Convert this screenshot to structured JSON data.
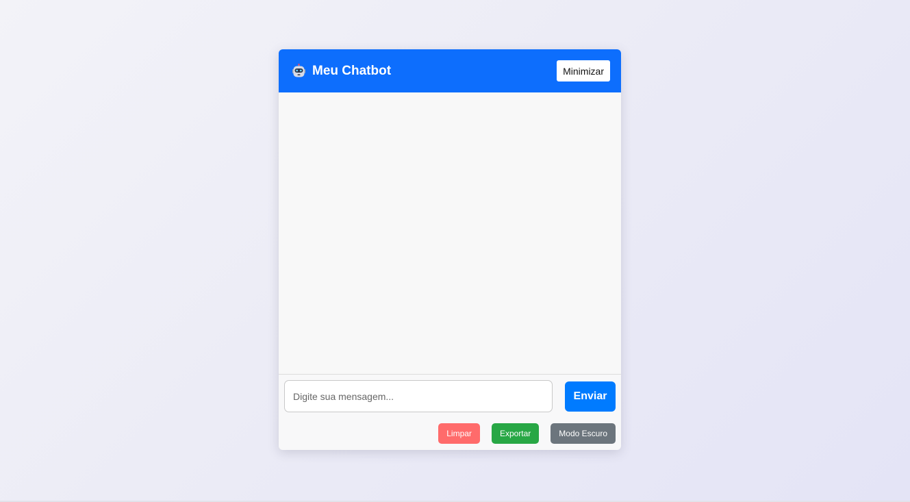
{
  "header": {
    "icon": "robot-icon",
    "title": "Meu Chatbot",
    "minimize_label": "Minimizar",
    "bg_color": "#0d6efd"
  },
  "input": {
    "placeholder": "Digite sua mensagem...",
    "value": "",
    "send_label": "Enviar"
  },
  "actions": {
    "clear_label": "Limpar",
    "export_label": "Exportar",
    "dark_mode_label": "Modo Escuro"
  },
  "colors": {
    "send": "#007bff",
    "clear": "#ff6b6b",
    "export": "#28a745",
    "dark_mode": "#6c757d"
  }
}
